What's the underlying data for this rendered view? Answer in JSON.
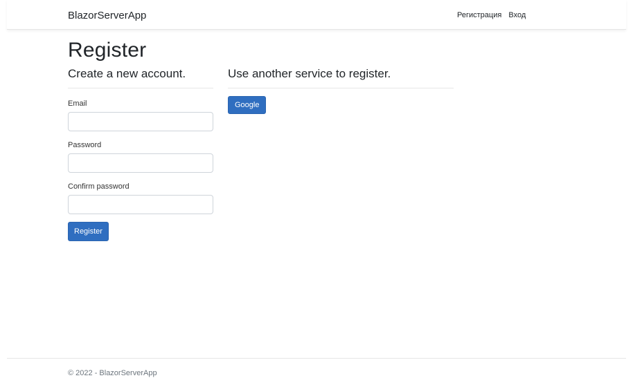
{
  "navbar": {
    "brand": "BlazorServerApp",
    "links": [
      "Регистрация",
      "Вход"
    ]
  },
  "page": {
    "title": "Register"
  },
  "register_form": {
    "heading": "Create a new account.",
    "email_label": "Email",
    "password_label": "Password",
    "confirm_label": "Confirm password",
    "submit_label": "Register"
  },
  "external": {
    "heading": "Use another service to register.",
    "providers": [
      "Google"
    ]
  },
  "footer": {
    "text": "© 2022 - BlazorServerApp"
  },
  "colors": {
    "primary": "#2f6ec0",
    "text": "#212529",
    "muted": "#6c757d"
  }
}
